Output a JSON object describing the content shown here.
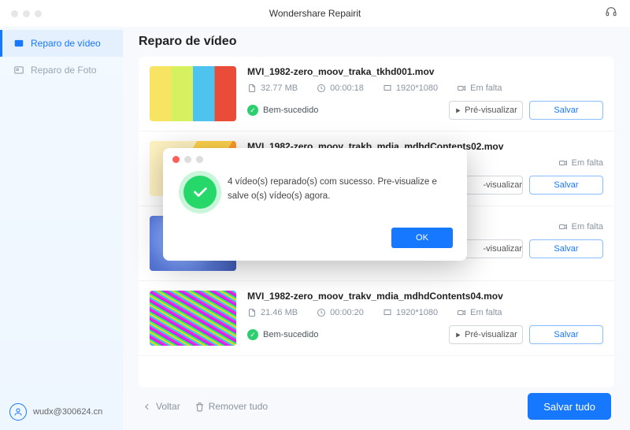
{
  "app": {
    "title": "Wondershare Repairit"
  },
  "sidebar": {
    "items": [
      {
        "label": "Reparo de vídeo"
      },
      {
        "label": "Reparo de Foto"
      }
    ]
  },
  "user": {
    "email": "wudx@300624.cn"
  },
  "page": {
    "title": "Reparo de vídeo"
  },
  "labels": {
    "preview": "Pré-visualizar",
    "save": "Salvar",
    "success": "Bem-sucedido",
    "missing": "Em falta",
    "back": "Voltar",
    "remove_all": "Remover tudo",
    "save_all": "Salvar tudo"
  },
  "videos": [
    {
      "name": "MVI_1982-zero_moov_traka_tkhd001.mov",
      "size": "32.77 MB",
      "duration": "00:00:18",
      "resolution": "1920*1080"
    },
    {
      "name": "MVI_1982-zero_moov_trakb_mdia_mdhdContents02.mov",
      "size": "",
      "duration": "",
      "resolution": ""
    },
    {
      "name": "",
      "size": "",
      "duration": "",
      "resolution": ""
    },
    {
      "name": "MVI_1982-zero_moov_trakv_mdia_mdhdContents04.mov",
      "size": "21.46 MB",
      "duration": "00:00:20",
      "resolution": "1920*1080"
    }
  ],
  "dialog": {
    "message": "4 vídeo(s) reparado(s) com sucesso. Pre-visualize e salve o(s) vídeo(s) agora.",
    "ok": "OK"
  }
}
